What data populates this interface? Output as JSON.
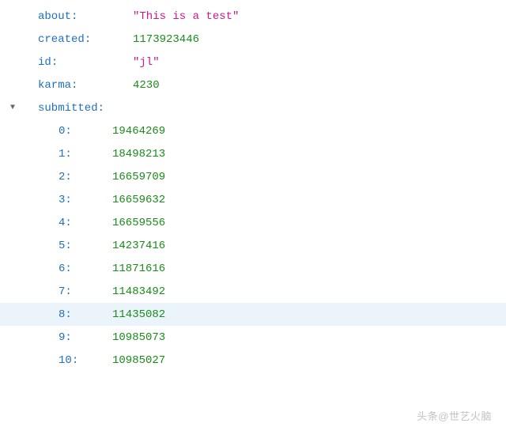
{
  "fields": {
    "about": {
      "key": "about",
      "value": "\"This is a test\"",
      "type": "string"
    },
    "created": {
      "key": "created",
      "value": "1173923446",
      "type": "number"
    },
    "id": {
      "key": "id",
      "value": "\"jl\"",
      "type": "string"
    },
    "karma": {
      "key": "karma",
      "value": "4230",
      "type": "number"
    },
    "submitted": {
      "key": "submitted"
    }
  },
  "submitted_items": [
    {
      "index": "0",
      "value": "19464269"
    },
    {
      "index": "1",
      "value": "18498213"
    },
    {
      "index": "2",
      "value": "16659709"
    },
    {
      "index": "3",
      "value": "16659632"
    },
    {
      "index": "4",
      "value": "16659556"
    },
    {
      "index": "5",
      "value": "14237416"
    },
    {
      "index": "6",
      "value": "11871616"
    },
    {
      "index": "7",
      "value": "11483492"
    },
    {
      "index": "8",
      "value": "11435082"
    },
    {
      "index": "9",
      "value": "10985073"
    },
    {
      "index": "10",
      "value": "10985027"
    }
  ],
  "watermark": "头条@世艺火脑"
}
